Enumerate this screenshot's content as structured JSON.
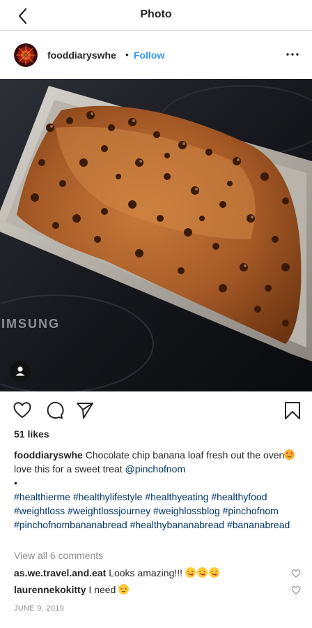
{
  "topbar": {
    "title": "Photo"
  },
  "header": {
    "username": "fooddiaryswhe",
    "separator": "•",
    "follow_label": "Follow"
  },
  "photo": {
    "brand_text": "IMSUNG"
  },
  "likes": {
    "text": "51 likes"
  },
  "caption": {
    "username": "fooddiaryswhe",
    "text_before_emoji": "Chocolate chip banana loaf fresh out the oven",
    "text_after_emoji": " love this for a sweet treat ",
    "mention": "@pinchofnom",
    "bullet": "•",
    "hashtags": [
      "#healthierme",
      "#healthylifestyle",
      "#healthyeating",
      "#healthyfood",
      "#weightloss",
      "#weightlossjourney",
      "#weighlossblog",
      "#pinchofnom",
      "#pinchofnombananabread",
      "#healthybananabread",
      "#bananabread"
    ]
  },
  "view_all_comments": "View all 6 comments",
  "comments": [
    {
      "username": "as.we.travel.and.eat",
      "text": "Looks amazing!!!"
    },
    {
      "username": "laurennekokitty",
      "text": "I need"
    }
  ],
  "date": "JUNE 9, 2019",
  "icons": {
    "back": "chevron-left-icon",
    "more": "more-horizontal-icon",
    "like": "heart-outline-icon",
    "comment": "comment-bubble-icon",
    "share": "paper-plane-icon",
    "save": "bookmark-icon",
    "tagged_user": "user-tag-icon",
    "comment_like": "small-heart-icon"
  },
  "colors": {
    "link_blue": "#3897f0",
    "hashtag": "#003569",
    "muted": "#8e8e8e",
    "text": "#262626"
  }
}
